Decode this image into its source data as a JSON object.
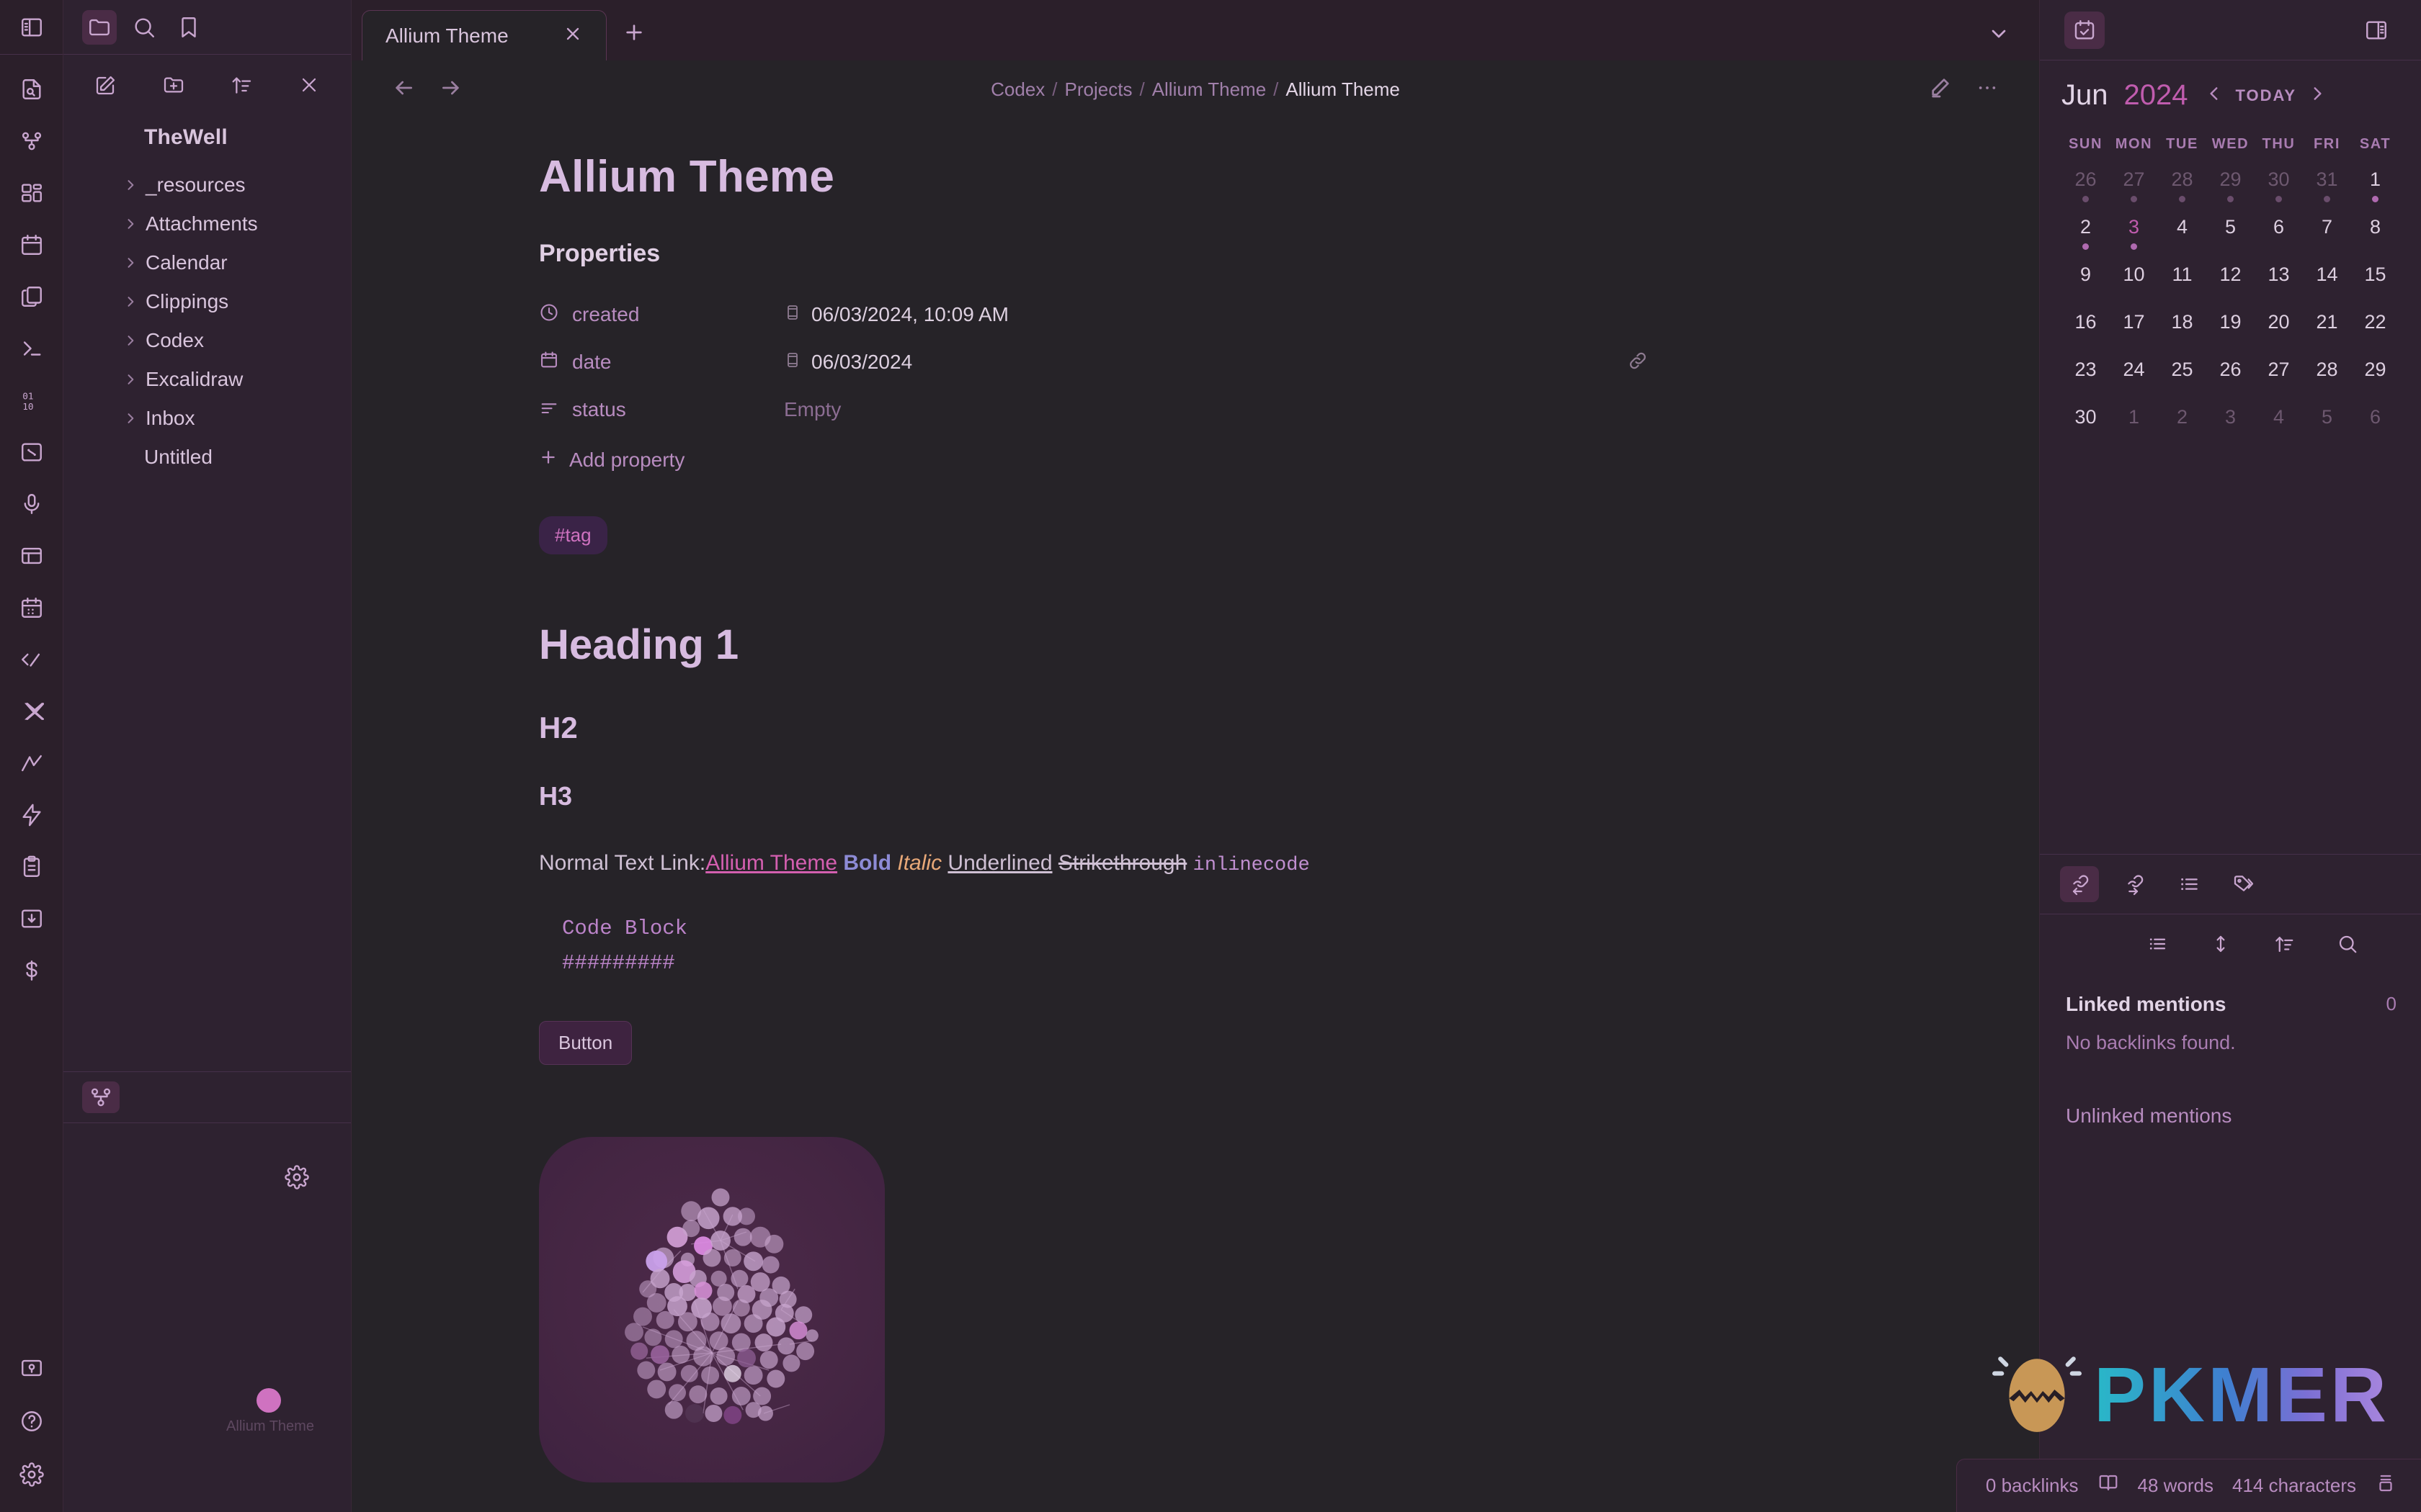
{
  "rail": {
    "top_icon": "sidebar-toggle-icon",
    "icons": [
      "file-search-icon",
      "graph-icon",
      "dashboard-icon",
      "calendar-icon",
      "copy-files-icon",
      "terminal-icon",
      "binary-icon",
      "canvas-icon",
      "microphone-icon",
      "table-icon",
      "calendar-plus-icon",
      "code-percent-icon",
      "scissors-icon",
      "activity-icon",
      "zap-icon",
      "clipboard-icon",
      "import-icon",
      "dollar-icon"
    ],
    "bottom_icons": [
      "vault-icon",
      "help-icon",
      "settings-icon"
    ]
  },
  "sidebar": {
    "header_icons": [
      "folder-icon",
      "search-icon",
      "bookmark-icon"
    ],
    "toolbar_icons": [
      "new-note-icon",
      "new-folder-icon",
      "sort-icon",
      "collapse-icon"
    ],
    "vault_name": "TheWell",
    "items": [
      {
        "label": "_resources",
        "type": "folder"
      },
      {
        "label": "Attachments",
        "type": "folder"
      },
      {
        "label": "Calendar",
        "type": "folder"
      },
      {
        "label": "Clippings",
        "type": "folder"
      },
      {
        "label": "Codex",
        "type": "folder"
      },
      {
        "label": "Excalidraw",
        "type": "folder"
      },
      {
        "label": "Inbox",
        "type": "folder"
      },
      {
        "label": "Untitled",
        "type": "file"
      }
    ],
    "graph_panel": {
      "icon": "graph-icon",
      "settings_icon": "gear-icon",
      "node_label": "Allium Theme"
    }
  },
  "tabbar": {
    "tabs": [
      {
        "label": "Allium Theme",
        "active": true
      }
    ],
    "new_tab_icon": "plus-icon",
    "right_icons": [
      "chevron-down-icon"
    ],
    "far_right_icons": [
      "calendar-check-icon",
      "right-sidebar-toggle-icon"
    ]
  },
  "viewheader": {
    "back_icon": "arrow-left-icon",
    "forward_icon": "arrow-right-icon",
    "breadcrumb": [
      "Codex",
      "Projects",
      "Allium Theme",
      "Allium Theme"
    ],
    "edit_icon": "pencil-icon",
    "more_icon": "more-horizontal-icon"
  },
  "document": {
    "title": "Allium Theme",
    "properties_heading": "Properties",
    "properties": [
      {
        "icon": "clock-icon",
        "key": "created",
        "value": "06/03/2024, 10:09 AM",
        "value_icon": "date-icon",
        "has_link": false
      },
      {
        "icon": "calendar-icon",
        "key": "date",
        "value": "06/03/2024",
        "value_icon": "date-icon",
        "has_link": true
      },
      {
        "icon": "list-icon",
        "key": "status",
        "value": "Empty",
        "value_icon": null,
        "has_link": false
      }
    ],
    "add_property_label": "Add property",
    "tag": "#tag",
    "heading1": "Heading 1",
    "heading2": "H2",
    "heading3": "H3",
    "paragraph": {
      "normal": "Normal Text Link:",
      "link": "Allium Theme",
      "bold": "Bold",
      "italic": "Italic",
      "underlined": "Underlined",
      "strikethrough": "Strikethrough",
      "inlinecode": "inlinecode"
    },
    "code_block": [
      "Code Block",
      "#########"
    ],
    "button_label": "Button",
    "image_alt": "allium-graph-image"
  },
  "calendar": {
    "month": "Jun",
    "year": "2024",
    "prev_icon": "chevron-left-icon",
    "today_label": "TODAY",
    "next_icon": "chevron-right-icon",
    "dow": [
      "SUN",
      "MON",
      "TUE",
      "WED",
      "THU",
      "FRI",
      "SAT"
    ],
    "weeks": [
      [
        {
          "d": "26",
          "out": true,
          "dot": "off"
        },
        {
          "d": "27",
          "out": true,
          "dot": "off"
        },
        {
          "d": "28",
          "out": true,
          "dot": "off"
        },
        {
          "d": "29",
          "out": true,
          "dot": "off"
        },
        {
          "d": "30",
          "out": true,
          "dot": "off"
        },
        {
          "d": "31",
          "out": true,
          "dot": "off"
        },
        {
          "d": "1",
          "out": false,
          "dot": "on"
        }
      ],
      [
        {
          "d": "2",
          "out": false,
          "dot": "on"
        },
        {
          "d": "3",
          "out": false,
          "dot": "on",
          "today": true
        },
        {
          "d": "4",
          "out": false
        },
        {
          "d": "5",
          "out": false
        },
        {
          "d": "6",
          "out": false
        },
        {
          "d": "7",
          "out": false
        },
        {
          "d": "8",
          "out": false
        }
      ],
      [
        {
          "d": "9",
          "out": false
        },
        {
          "d": "10",
          "out": false
        },
        {
          "d": "11",
          "out": false
        },
        {
          "d": "12",
          "out": false
        },
        {
          "d": "13",
          "out": false
        },
        {
          "d": "14",
          "out": false
        },
        {
          "d": "15",
          "out": false
        }
      ],
      [
        {
          "d": "16",
          "out": false
        },
        {
          "d": "17",
          "out": false
        },
        {
          "d": "18",
          "out": false
        },
        {
          "d": "19",
          "out": false
        },
        {
          "d": "20",
          "out": false
        },
        {
          "d": "21",
          "out": false
        },
        {
          "d": "22",
          "out": false
        }
      ],
      [
        {
          "d": "23",
          "out": false
        },
        {
          "d": "24",
          "out": false
        },
        {
          "d": "25",
          "out": false
        },
        {
          "d": "26",
          "out": false
        },
        {
          "d": "27",
          "out": false
        },
        {
          "d": "28",
          "out": false
        },
        {
          "d": "29",
          "out": false
        }
      ],
      [
        {
          "d": "30",
          "out": false
        },
        {
          "d": "1",
          "out": true
        },
        {
          "d": "2",
          "out": true
        },
        {
          "d": "3",
          "out": true
        },
        {
          "d": "4",
          "out": true
        },
        {
          "d": "5",
          "out": true
        },
        {
          "d": "6",
          "out": true
        }
      ]
    ]
  },
  "backlinks": {
    "tabs": [
      "backlink-icon",
      "outgoing-link-icon",
      "outline-icon",
      "tags-icon"
    ],
    "tools": [
      "list-icon",
      "collapse-expand-icon",
      "sort-icon",
      "search-icon"
    ],
    "linked_title": "Linked mentions",
    "linked_count": "0",
    "no_backlinks": "No backlinks found.",
    "unlinked_title": "Unlinked mentions"
  },
  "statusbar": {
    "backlinks": "0 backlinks",
    "reading_icon": "book-icon",
    "words": "48 words",
    "characters": "414 characters",
    "layout_icon": "stack-icon"
  },
  "watermark": {
    "text": "PKMER",
    "logo": "cracked-egg-icon"
  },
  "colors": {
    "accent": "#c9a6cf",
    "pink": "#d06aad",
    "bg_main": "#262328",
    "bg_sidebar": "#2e2230",
    "highlight": "#4a2c46"
  }
}
